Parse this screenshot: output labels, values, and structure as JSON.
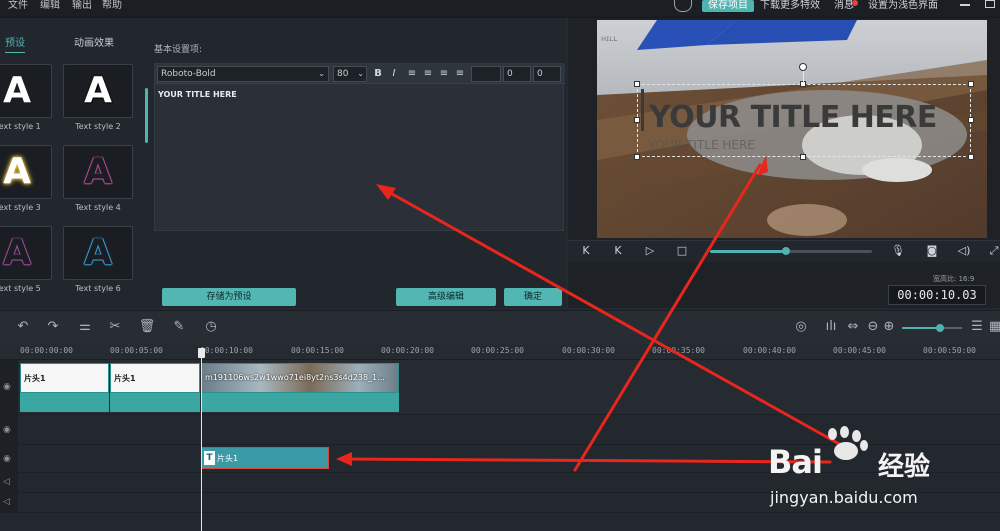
{
  "menu": [
    "文件",
    "编辑",
    "输出",
    "帮助"
  ],
  "topbar": {
    "save_project": "保存项目",
    "download_effects": "下载更多特效",
    "messages": "消息",
    "light_mode": "设置为浅色界面"
  },
  "left_panel": {
    "tabs": [
      "预设",
      "动画效果"
    ],
    "styles": [
      {
        "glyph": "A",
        "label": "Text style 1"
      },
      {
        "glyph": "A",
        "label": "Text style 2"
      },
      {
        "glyph": "A",
        "label": "Text style 3"
      },
      {
        "glyph": "A",
        "label": "Text style 4"
      },
      {
        "glyph": "A",
        "label": "Text style 5"
      },
      {
        "glyph": "A",
        "label": "Text style 6"
      }
    ]
  },
  "editor": {
    "section_label": "基本设置项:",
    "font": "Roboto-Bold",
    "size": "80",
    "bold": "B",
    "italic": "I",
    "spin1": "0",
    "spin2": "0",
    "text_content": "YOUR TITLE HERE",
    "save_preset": "存储为预设",
    "advanced_edit": "高级编辑",
    "confirm": "确定"
  },
  "preview": {
    "title_text": "YOUR TITLE HERE",
    "subtitle_text": "YOUR TITLE HERE",
    "aspect_ratio": "宽高比: 16:9",
    "timecode": "00:00:10.03",
    "progress": 0.47
  },
  "timeline": {
    "ticks": [
      "00:00:00:00",
      "00:00:05:00",
      "00:00:10:00",
      "00:00:15:00",
      "00:00:20:00",
      "00:00:25:00",
      "00:00:30:00",
      "00:00:35:00",
      "00:00:40:00",
      "00:00:45:00",
      "00:00:50:00"
    ],
    "clip1": "片头1",
    "clip2": "片头1",
    "video_clip": "m191106ws2w1wwo71ei8yt2ns3s4d238_1...",
    "text_clip": "片头1"
  },
  "watermark": {
    "brand": "Bai",
    "brand2": "经验",
    "url": "jingyan.baidu.com"
  },
  "colors": {
    "accent": "#4fb3b0",
    "arrow": "#e8261c",
    "background": "#252a31"
  }
}
